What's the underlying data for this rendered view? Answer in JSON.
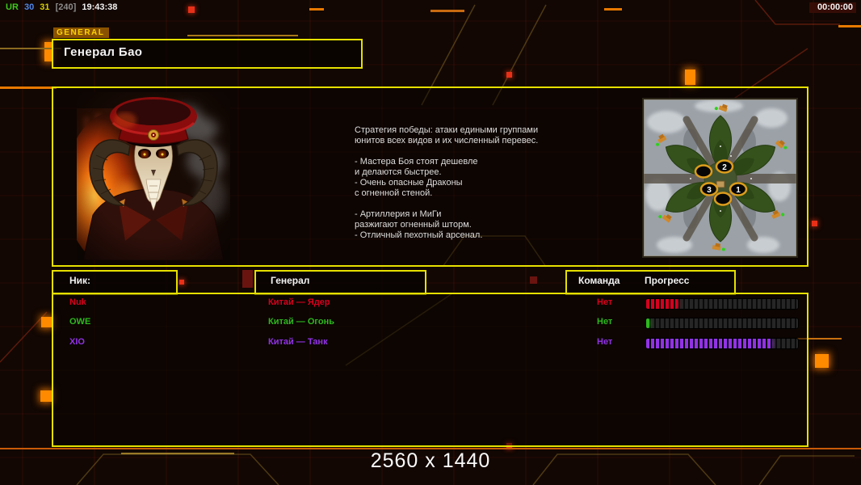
{
  "session": {
    "tag": "UR",
    "num1": "30",
    "num2": "31",
    "bracket": "[240]",
    "clock": "19:43:38",
    "timer": "00:00:00"
  },
  "header": {
    "tab_label": "GENERAL",
    "title": "Генерал Бао"
  },
  "strategy": {
    "text": "Стратегия победы: атаки едиными группами\nюнитов всех видов и их численный перевес.\n\n- Мастера Боя стоят дешевле\nи делаются быстрее.\n- Очень опасные Драконы\nс огненной стеной.\n\n- Артиллерия и МиГи\nразжигают огненный шторм.\n- Отличный пехотный арсенал."
  },
  "minimap": {
    "start_markers": [
      "2",
      "",
      "3",
      "1",
      ""
    ]
  },
  "players": {
    "headers": {
      "nick": "Ник:",
      "general": "Генерал",
      "team": "Команда",
      "progress": "Прогресс"
    },
    "rows": [
      {
        "name": "Nuk",
        "general": "Китай — Ядер",
        "team": "Нет",
        "progress_pct": 21,
        "color": "#d6001e"
      },
      {
        "name": "OWE",
        "general": "Китай — Огонь",
        "team": "Нет",
        "progress_pct": 2,
        "color": "#2eb81e"
      },
      {
        "name": "XIO",
        "general": "Китай — Танк",
        "team": "Нет",
        "progress_pct": 83,
        "color": "#9232e6"
      }
    ]
  },
  "footer": {
    "resolution": "2560 x 1440"
  },
  "colors": {
    "accent_yellow": "#e6e000",
    "accent_orange": "#ff8a00",
    "grid_red": "#96201e",
    "background": "#120703"
  }
}
